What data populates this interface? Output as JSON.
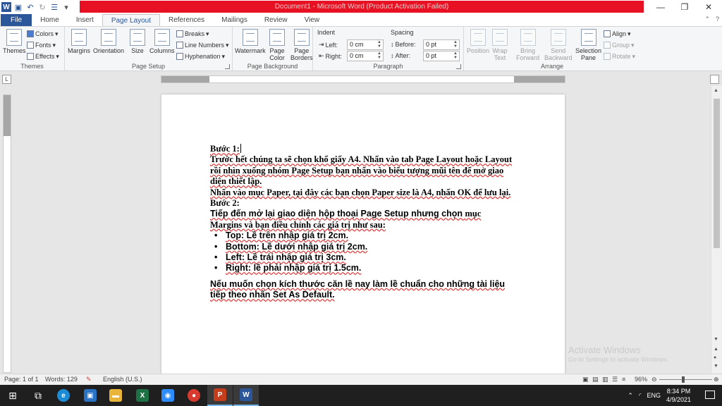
{
  "window": {
    "title": "Document1 - Microsoft Word (Product Activation Failed)",
    "accent": "#2b579a",
    "alert_color": "#e81123"
  },
  "tabs": [
    "File",
    "Home",
    "Insert",
    "Page Layout",
    "References",
    "Mailings",
    "Review",
    "View"
  ],
  "ribbon": {
    "themes": {
      "themes": "Themes",
      "colors": "Colors",
      "fonts": "Fonts",
      "effects": "Effects",
      "label": "Themes"
    },
    "page_setup": {
      "margins": "Margins",
      "orientation": "Orientation",
      "size": "Size",
      "columns": "Columns",
      "breaks": "Breaks",
      "line_numbers": "Line Numbers",
      "hyphenation": "Hyphenation",
      "label": "Page Setup"
    },
    "page_background": {
      "watermark": "Watermark",
      "page_color_1": "Page",
      "page_color_2": "Color",
      "page_borders_1": "Page",
      "page_borders_2": "Borders",
      "label": "Page Background"
    },
    "paragraph": {
      "indent": "Indent",
      "spacing": "Spacing",
      "left": "Left:",
      "right": "Right:",
      "before": "Before:",
      "after": "After:",
      "left_value": "0 cm",
      "right_value": "0 cm",
      "before_value": "0 pt",
      "after_value": "0 pt",
      "label": "Paragraph"
    },
    "arrange": {
      "position": "Position",
      "wrap_1": "Wrap",
      "wrap_2": "Text",
      "bring_1": "Bring",
      "bring_2": "Forward",
      "send_1": "Send",
      "send_2": "Backward",
      "selection_1": "Selection",
      "selection_2": "Pane",
      "align": "Align",
      "group": "Group",
      "rotate": "Rotate",
      "label": "Arrange"
    }
  },
  "document": {
    "step1_heading": "Bước 1:",
    "step1_p1": "Trước hết chúng ta sẽ chọn khổ giấy A4. Nhấn vào tab Page Layout hoặc Layout rồi nhìn xuống nhóm Page Setup bạn nhấn vào biểu tượng mũi tên để mở giao diện thiết lập.",
    "step1_p2": " Nhấn vào mục Paper, tại đây các bạn chọn Paper size là A4, nhấn OK để lưu lại.",
    "step2_heading": "Bước 2:",
    "step2_p1a": "Tiếp đến mở lại giao diện hộp thoại Page Setup nhưng chọn ",
    "step2_p1b": "mục Margins và bạn điều chỉnh các giá trị như sau:",
    "bullets": [
      "Top: Lề trên nhập giá trị 2cm.",
      "Bottom: Lề dưới nhập giá trị 2cm.",
      "Left: Lề trái nhập giá trị 3cm.",
      "Right: lề phải nhập giá trị 1.5cm."
    ],
    "final_p": "Nếu muốn chọn kích thước căn lề nay làm lề chuẩn cho những tài liệu tiếp theo nhấn Set As Default."
  },
  "watermark": {
    "line1": "Activate Windows",
    "line2": "Go to Settings to activate Windows."
  },
  "status": {
    "page": "Page: 1 of 1",
    "words": "Words: 129",
    "language": "English (U.S.)",
    "zoom": "96%"
  },
  "taskbar": {
    "language": "ENG",
    "time": "8:34 PM",
    "date": "4/9/2021"
  }
}
